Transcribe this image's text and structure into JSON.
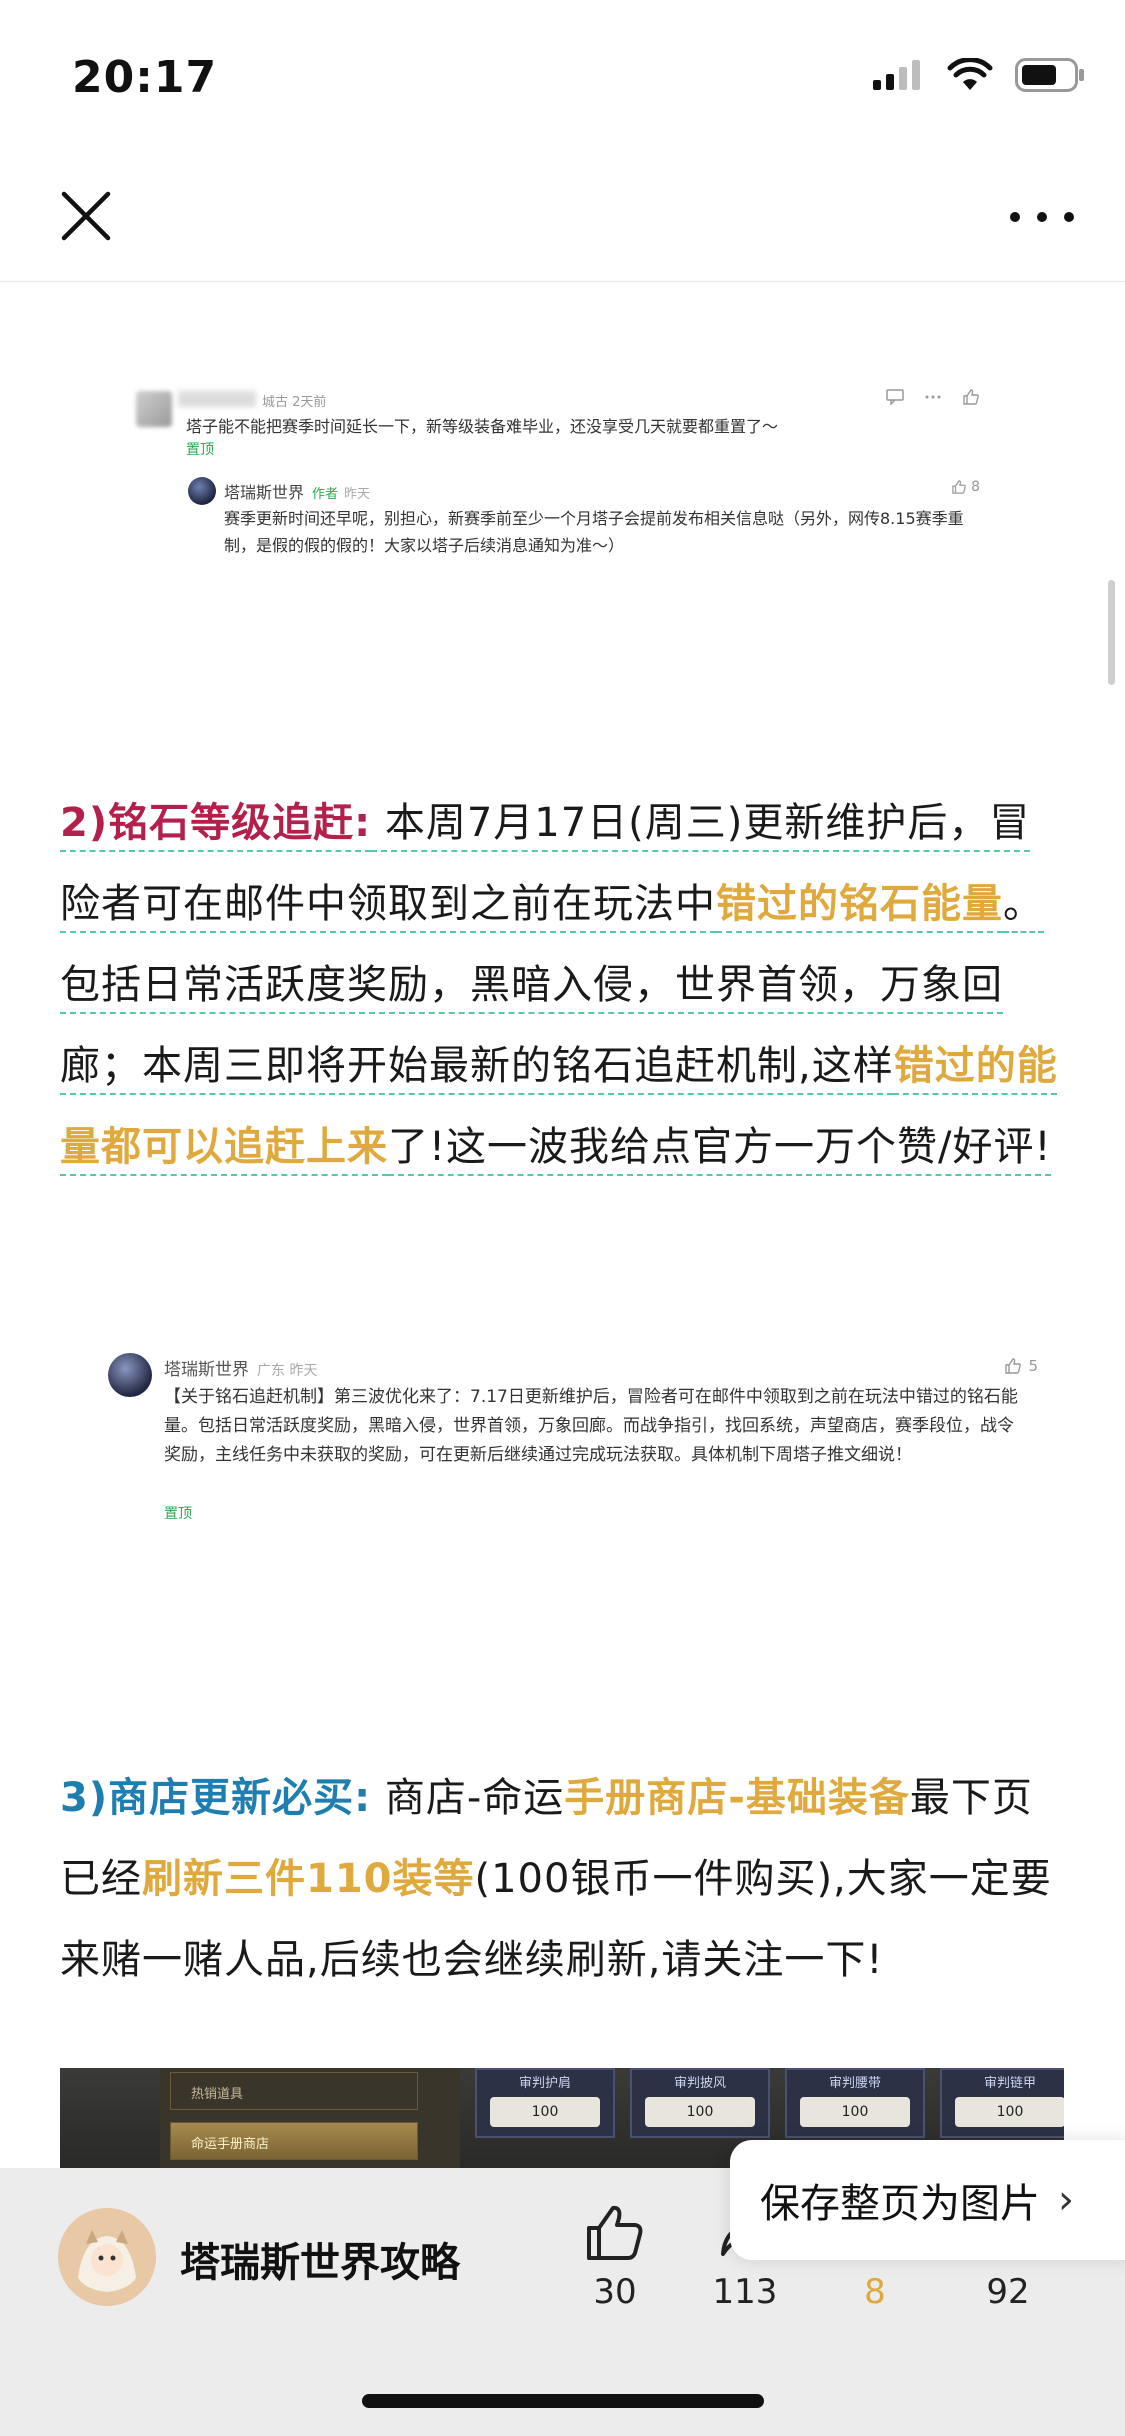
{
  "status_bar": {
    "time": "20:17"
  },
  "comment1": {
    "meta": "城古 2天前",
    "text": "塔子能不能把赛季时间延长一下，新等级装备难毕业，还没享受几天就要都重置了～",
    "pin": "置顶",
    "reply": {
      "name": "塔瑞斯世界",
      "author_tag": "作者",
      "time": "昨天",
      "likes": "8",
      "text": "赛季更新时间还早呢，别担心，新赛季前至少一个月塔子会提前发布相关信息哒（另外，网传8.15赛季重制，是假的假的假的！大家以塔子后续消息通知为准～）"
    }
  },
  "para1": {
    "heading": "2)铭石等级追赶:",
    "t1": " 本周7月17日(周三)更新维护后，冒险者可在邮件中领取到之前在玩法中",
    "h1": "错过的铭石能量",
    "t2": "。包括日常活跃度奖励，黑暗入侵，世界首领，万象回廊；本周三即将开始最新的铭石追赶机制,这样",
    "h2": "错过的能量都可以追赶上来",
    "t3": "了!这一波我给点官方一万个赞/好评!"
  },
  "comment2": {
    "name": "塔瑞斯世界",
    "meta": "广东 昨天",
    "likes": "5",
    "text": "【关于铭石追赶机制】第三波优化来了：7.17日更新维护后，冒险者可在邮件中领取到之前在玩法中错过的铭石能量。包括日常活跃度奖励，黑暗入侵，世界首领，万象回廊。而战争指引，找回系统，声望商店，赛季段位，战令奖励，主线任务中未获取的奖励，可在更新后继续通过完成玩法获取。具体机制下周塔子推文细说！",
    "pin": "置顶"
  },
  "para2": {
    "heading": "3)商店更新必买:",
    "t1": " 商店-命运",
    "h1": "手册商店-基础装备",
    "t2": "最下页已经",
    "h2": "刷新三件110装等",
    "t3": "(100银币一件购买),大家一定要来赌一赌人品,后续也会继续刷新,请关注一下!"
  },
  "game_shot": {
    "menu": [
      "热销道具",
      "命运手册商店"
    ],
    "cards": [
      {
        "title": "审判护肩",
        "price": "100"
      },
      {
        "title": "审判披风",
        "price": "100"
      },
      {
        "title": "审判腰带",
        "price": "100"
      },
      {
        "title": "审判链甲",
        "price": "100"
      }
    ]
  },
  "save_bubble": {
    "label": "保存整页为图片"
  },
  "bottom_bar": {
    "author_name": "塔瑞斯世界攻略",
    "likes": "30",
    "shares": "113",
    "favorites": "8",
    "comments": "92"
  },
  "colors": {
    "heading_red": "#b3214b",
    "heading_blue": "#1f7eb0",
    "highlight_gold": "#e0a93d",
    "pin_green": "#2aa84f"
  }
}
